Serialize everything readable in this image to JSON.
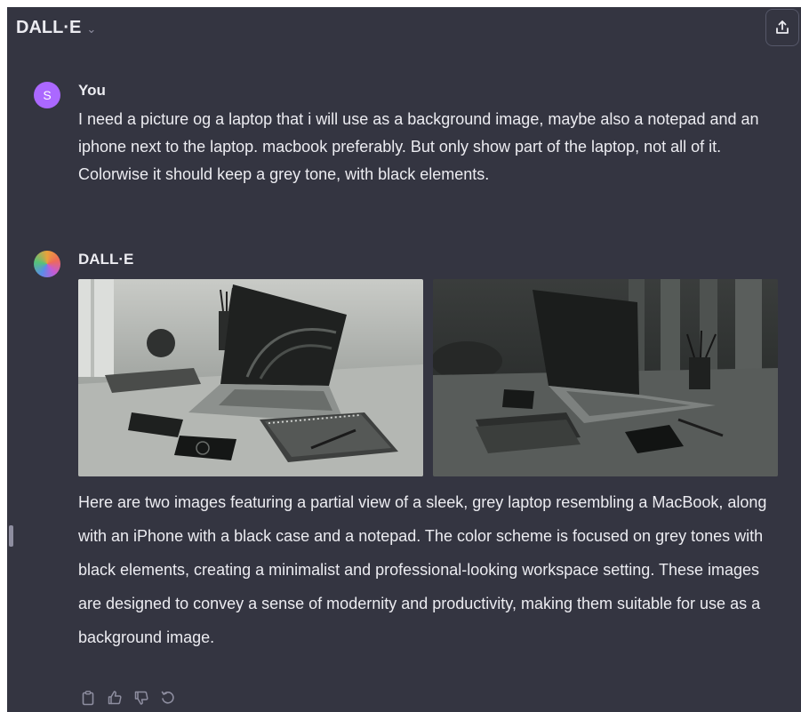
{
  "header": {
    "model_name": "DALL·E",
    "model_chevron_icon": "chevron-down-icon",
    "share_icon": "share-icon"
  },
  "conversation": {
    "user_message": {
      "avatar_initial": "S",
      "avatar_color": "#ab68ff",
      "author": "You",
      "text": "I need a picture og a laptop that i will use as a background image, maybe also a notepad and an iphone  next to the laptop. macbook preferably.  But only show part of the laptop, not all of it. Colorwise it should keep a grey tone, with black elements."
    },
    "assistant_message": {
      "author": "DALL·E",
      "images": [
        {
          "name": "generated-image-1",
          "tone": "light-grey"
        },
        {
          "name": "generated-image-2",
          "tone": "dark-grey"
        }
      ],
      "text": "Here are two images featuring a partial view of a sleek, grey laptop resembling a MacBook, along with an iPhone with a black case and a notepad. The color scheme is focused on grey tones with black elements, creating a minimalist and professional-looking workspace setting. These images are designed to convey a sense of modernity and productivity, making them suitable for use as a background image.",
      "actions": [
        "copy-icon",
        "thumbs-up-icon",
        "thumbs-down-icon",
        "regenerate-icon"
      ]
    }
  },
  "colors": {
    "background": "#343541",
    "text": "#ececf1",
    "muted": "#8e8ea0"
  }
}
